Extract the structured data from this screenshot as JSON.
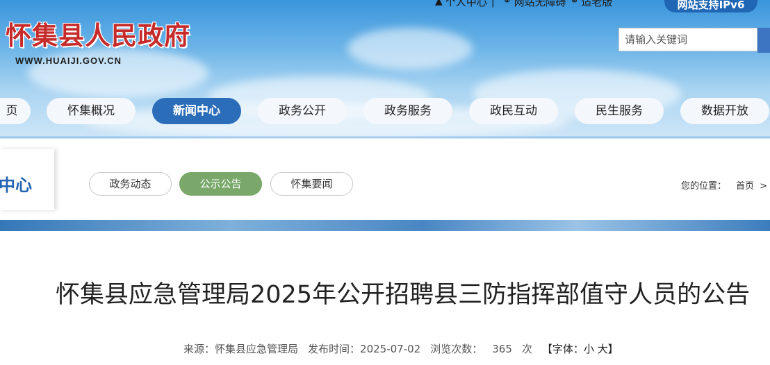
{
  "header": {
    "top_links": [
      "个人中心",
      "网站无障碍",
      "适老版"
    ],
    "site_support": "网站支持IPv6",
    "site_title": "怀集县人民政府",
    "domain": "WWW.HUAIJI.GOV.CN",
    "search_placeholder": "请输入关键词"
  },
  "nav": {
    "items": [
      "页",
      "怀集概况",
      "新闻中心",
      "政务公开",
      "政务服务",
      "政民互动",
      "民生服务",
      "数据开放"
    ],
    "active": "新闻中心"
  },
  "section": {
    "title": "中心",
    "tabs": [
      "政务动态",
      "公示公告",
      "怀集要闻"
    ],
    "active_tab": "公示公告"
  },
  "breadcrumb": {
    "label": "您的位置：",
    "home": "首页",
    "separator": ">"
  },
  "article": {
    "title": "怀集县应急管理局2025年公开招聘县三防指挥部值守人员的公告",
    "source_label": "来源：",
    "source": "怀集县应急管理局",
    "date_label": "发布时间：",
    "date": "2025-07-02",
    "views_label": "浏览次数：",
    "views": "365",
    "views_unit": "次",
    "font_label": "【字体：",
    "font_small": "小",
    "font_large": "大",
    "font_close": "】"
  }
}
